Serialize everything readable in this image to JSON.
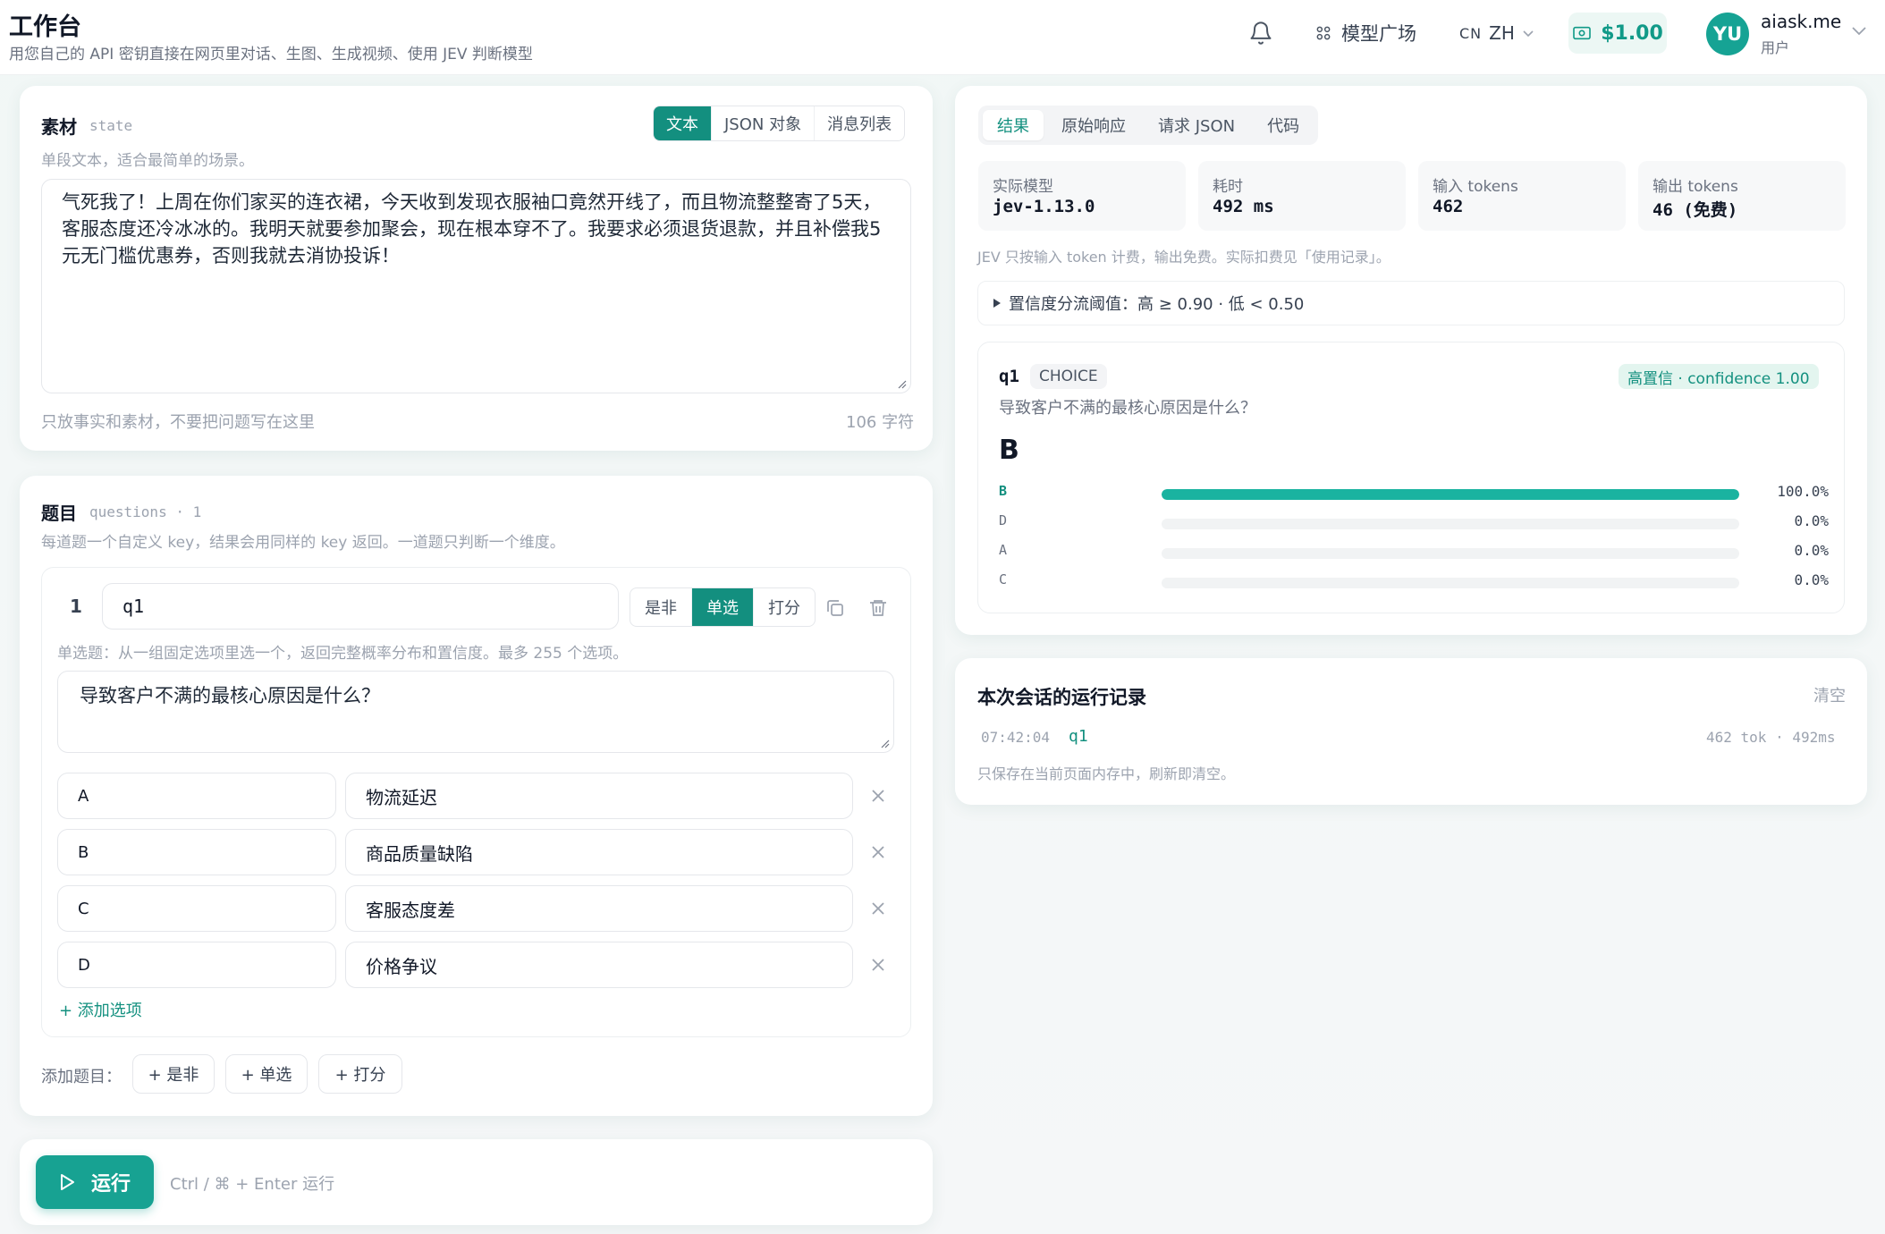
{
  "header": {
    "title": "工作台",
    "subtitle": "用您自己的 API 密钥直接在网页里对话、生图、生成视频、使用 JEV 判断模型",
    "nav_models": "模型广场",
    "lang_code": "CN",
    "lang_label": "ZH",
    "balance": "$1.00",
    "avatar_initials": "YU",
    "user_name": "aiask.me",
    "user_role": "用户"
  },
  "material": {
    "title": "素材",
    "tag": "state",
    "modes": [
      "文本",
      "JSON 对象",
      "消息列表"
    ],
    "active_mode": "文本",
    "hint": "单段文本，适合最简单的场景。",
    "text": "气死我了！上周在你们家买的连衣裙，今天收到发现衣服袖口竟然开线了，而且物流整整寄了5天，客服态度还冷冰冰的。我明天就要参加聚会，现在根本穿不了。我要求必须退货退款，并且补偿我5元无门槛优惠券，否则我就去消协投诉！",
    "footer_hint": "只放事实和素材，不要把问题写在这里",
    "char_count": "106 字符"
  },
  "questions": {
    "title": "题目",
    "tag": "questions · 1",
    "hint": "每道题一个自定义 key，结果会用同样的 key 返回。一道题只判断一个维度。",
    "items": [
      {
        "index": "1",
        "key": "q1",
        "types": [
          "是非",
          "单选",
          "打分"
        ],
        "active_type": "单选",
        "type_hint": "单选题：从一组固定选项里选一个，返回完整概率分布和置信度。最多 255 个选项。",
        "prompt": "导致客户不满的最核心原因是什么？",
        "options": [
          {
            "key": "A",
            "label": "物流延迟"
          },
          {
            "key": "B",
            "label": "商品质量缺陷"
          },
          {
            "key": "C",
            "label": "客服态度差"
          },
          {
            "key": "D",
            "label": "价格争议"
          }
        ],
        "add_option": "+ 添加选项"
      }
    ],
    "add_label": "添加题目：",
    "add_buttons": [
      "+ 是非",
      "+ 单选",
      "+ 打分"
    ]
  },
  "run": {
    "label": "运行",
    "hint": "Ctrl / ⌘ + Enter 运行"
  },
  "results": {
    "tabs": [
      "结果",
      "原始响应",
      "请求 JSON",
      "代码"
    ],
    "active_tab": "结果",
    "stats": [
      {
        "label": "实际模型",
        "value": "jev-1.13.0"
      },
      {
        "label": "耗时",
        "value": "492 ms"
      },
      {
        "label": "输入 tokens",
        "value": "462"
      },
      {
        "label": "输出 tokens",
        "value": "46 (免费)"
      }
    ],
    "billing_note": "JEV 只按输入 token 计费，输出免费。实际扣费见「使用记录」。",
    "threshold": "置信度分流阈值：高 ≥ 0.90 · 低 < 0.50",
    "answer": {
      "key": "q1",
      "type": "CHOICE",
      "confidence_badge": "高置信 · confidence 1.00",
      "question": "导致客户不满的最核心原因是什么？",
      "choice": "B",
      "distribution": [
        {
          "key": "B",
          "pct_label": "100.0%",
          "value": 1.0
        },
        {
          "key": "D",
          "pct_label": "0.0%",
          "value": 0.0
        },
        {
          "key": "A",
          "pct_label": "0.0%",
          "value": 0.0
        },
        {
          "key": "C",
          "pct_label": "0.0%",
          "value": 0.0
        }
      ]
    }
  },
  "log": {
    "title": "本次会话的运行记录",
    "clear": "清空",
    "entries": [
      {
        "time": "07:42:04",
        "key": "q1",
        "meta": "462 tok · 492ms"
      }
    ],
    "note": "只保存在当前页面内存中，刷新即清空。"
  },
  "colors": {
    "accent": "#138f7f",
    "accent_bright": "#1ab3a0",
    "badge_bg": "#e3f5ef",
    "badge_text": "#13907f"
  }
}
